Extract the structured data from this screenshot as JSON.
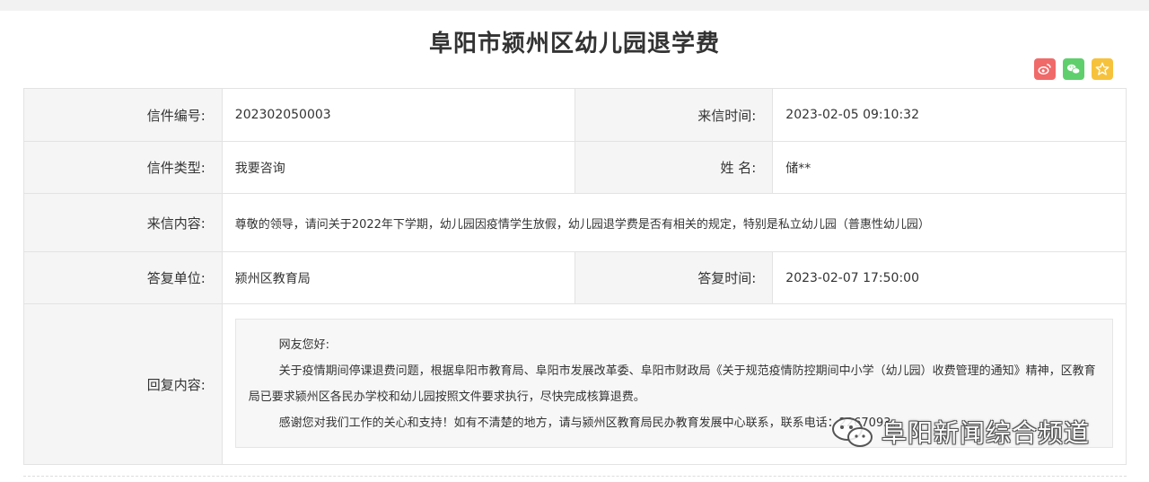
{
  "page": {
    "title": "阜阳市颍州区幼儿园退学费"
  },
  "share": {
    "icons": [
      "weibo-icon",
      "wechat-icon",
      "favorite-icon"
    ],
    "colors": {
      "weibo": "#f06a6a",
      "wechat": "#5fcf6d",
      "favorite": "#f7c23b"
    }
  },
  "letter": {
    "number_label": "信件编号:",
    "number_value": "202302050003",
    "received_label": "来信时间:",
    "received_value": "2023-02-05 09:10:32",
    "type_label": "信件类型:",
    "type_value": "我要咨询",
    "name_label": "姓 名:",
    "name_value": "储**",
    "content_label": "来信内容:",
    "content_value": "尊敬的领导，请问关于2022年下学期，幼儿园因疫情学生放假，幼儿园退学费是否有相关的规定，特别是私立幼儿园（普惠性幼儿园）",
    "reply_unit_label": "答复单位:",
    "reply_unit_value": "颍州区教育局",
    "reply_time_label": "答复时间:",
    "reply_time_value": "2023-02-07 17:50:00",
    "reply_content_label": "回复内容:",
    "reply_paragraphs": [
      "网友您好:",
      "关于疫情期间停课退费问题，根据阜阳市教育局、阜阳市发展改革委、阜阳市财政局《关于规范疫情防控期间中小学（幼儿园）收费管理的通知》精神，区教育局已要求颍州区各民办学校和幼儿园按照文件要求执行，尽快完成核算退费。",
      "感谢您对我们工作的关心和支持！如有不清楚的地方，请与颍州区教育局民办教育发展中心联系，联系电话：2267093。"
    ]
  },
  "watermark": {
    "text": "阜阳新闻综合频道"
  }
}
